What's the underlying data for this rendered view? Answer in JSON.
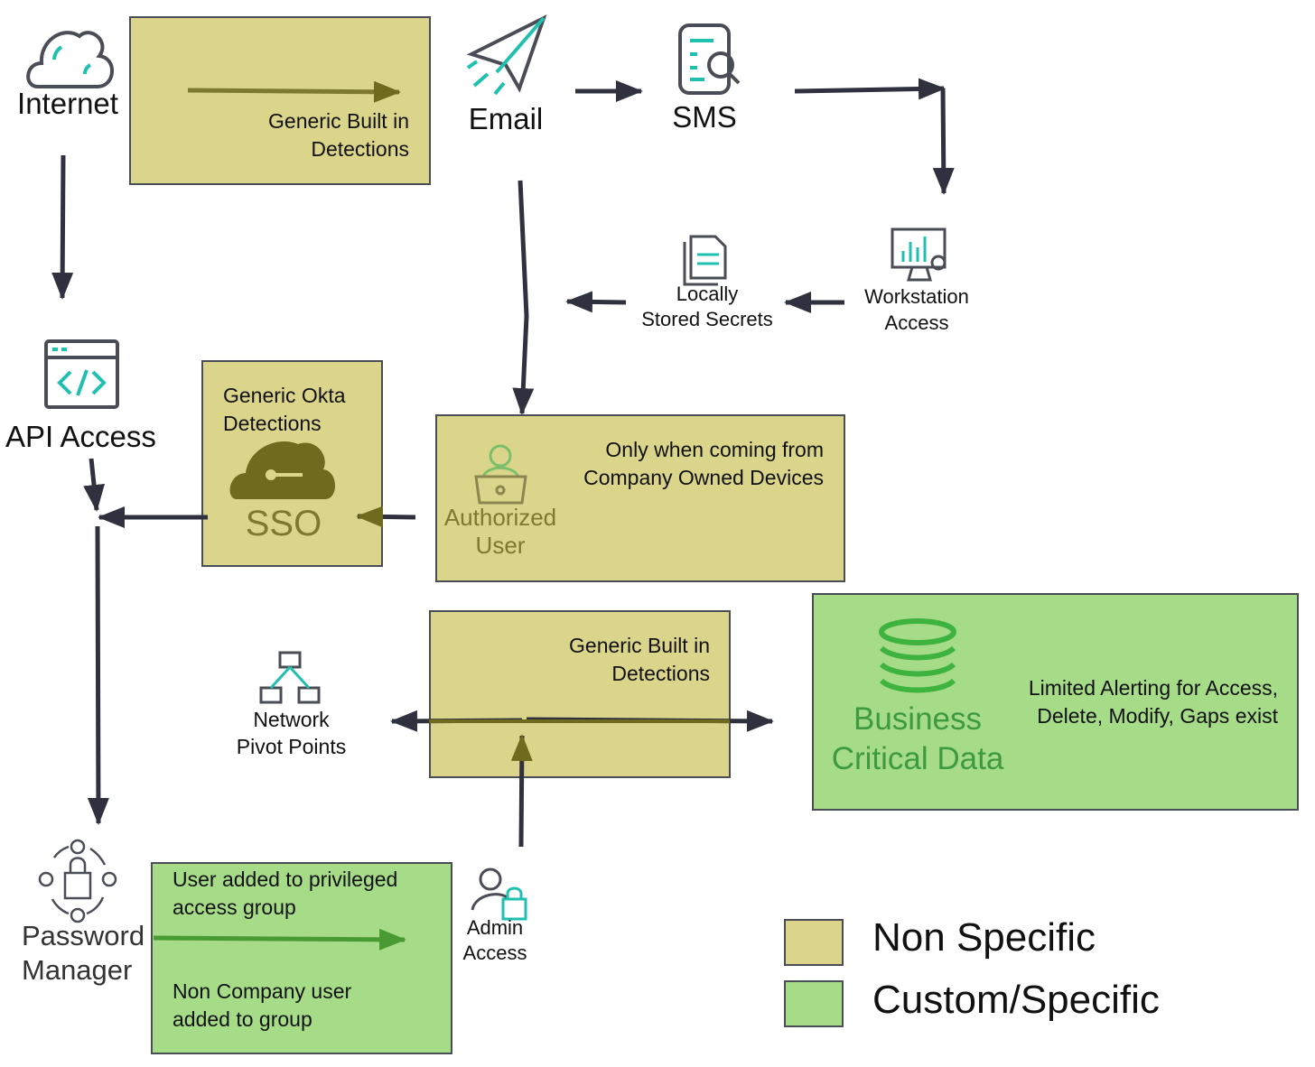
{
  "nodes": {
    "internet": "Internet",
    "email": "Email",
    "sms": "SMS",
    "workstation": [
      "Workstation",
      "Access"
    ],
    "locally_stored": [
      "Locally",
      "Stored Secrets"
    ],
    "api_access": "API Access",
    "sso": "SSO",
    "authorized_user": [
      "Authorized",
      "User"
    ],
    "network_pivot": [
      "Network",
      "Pivot Points"
    ],
    "business_data": [
      "Business",
      "Critical Data"
    ],
    "password_manager": [
      "Password",
      "Manager"
    ],
    "admin_access": [
      "Admin",
      "Access"
    ]
  },
  "boxes": {
    "top_generic": [
      "Generic Built in",
      "Detections"
    ],
    "okta": [
      "Generic Okta",
      "Detections"
    ],
    "company_devices": [
      "Only when coming from",
      "Company Owned Devices"
    ],
    "mid_generic": [
      "Generic Built in",
      "Detections"
    ],
    "limited_alerting": [
      "Limited Alerting for Access,",
      "Delete, Modify, Gaps exist"
    ],
    "privileged_group": [
      "User added to privileged",
      "access group"
    ],
    "non_company_user": [
      "Non Company user",
      "added to group"
    ]
  },
  "legend": [
    {
      "label": "Non Specific",
      "color": "#dbd58b"
    },
    {
      "label": "Custom/Specific",
      "color": "#a6dc88"
    }
  ],
  "colors": {
    "arrow": "#2f323e",
    "olive": "#6f6a1d",
    "teal": "#1fc0b0",
    "icon_gray": "#4a4d55"
  }
}
